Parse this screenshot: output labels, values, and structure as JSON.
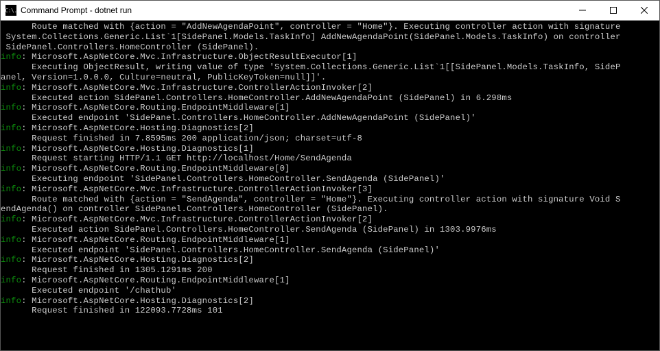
{
  "window": {
    "icon_text": "C:\\.",
    "title": "Command Prompt - dotnet  run"
  },
  "terminal": {
    "info_label": "info",
    "lines": [
      {
        "type": "indent6",
        "text": "Route matched with {action = \"AddNewAgendaPoint\", controller = \"Home\"}. Executing controller action with signature"
      },
      {
        "type": "plain",
        "text": " System.Collections.Generic.List`1[SidePanel.Models.TaskInfo] AddNewAgendaPoint(SidePanel.Models.TaskInfo) on controller"
      },
      {
        "type": "plain",
        "text": " SidePanel.Controllers.HomeController (SidePanel)."
      },
      {
        "type": "info",
        "text": "Microsoft.AspNetCore.Mvc.Infrastructure.ObjectResultExecutor[1]"
      },
      {
        "type": "indent6",
        "text": "Executing ObjectResult, writing value of type 'System.Collections.Generic.List`1[[SidePanel.Models.TaskInfo, SideP"
      },
      {
        "type": "plain",
        "text": "anel, Version=1.0.0.0, Culture=neutral, PublicKeyToken=null]]'."
      },
      {
        "type": "info",
        "text": "Microsoft.AspNetCore.Mvc.Infrastructure.ControllerActionInvoker[2]"
      },
      {
        "type": "indent6",
        "text": "Executed action SidePanel.Controllers.HomeController.AddNewAgendaPoint (SidePanel) in 6.298ms"
      },
      {
        "type": "info",
        "text": "Microsoft.AspNetCore.Routing.EndpointMiddleware[1]"
      },
      {
        "type": "indent6",
        "text": "Executed endpoint 'SidePanel.Controllers.HomeController.AddNewAgendaPoint (SidePanel)'"
      },
      {
        "type": "info",
        "text": "Microsoft.AspNetCore.Hosting.Diagnostics[2]"
      },
      {
        "type": "indent6",
        "text": "Request finished in 7.8595ms 200 application/json; charset=utf-8"
      },
      {
        "type": "info",
        "text": "Microsoft.AspNetCore.Hosting.Diagnostics[1]"
      },
      {
        "type": "indent6",
        "text": "Request starting HTTP/1.1 GET http://localhost/Home/SendAgenda"
      },
      {
        "type": "info",
        "text": "Microsoft.AspNetCore.Routing.EndpointMiddleware[0]"
      },
      {
        "type": "indent6",
        "text": "Executing endpoint 'SidePanel.Controllers.HomeController.SendAgenda (SidePanel)'"
      },
      {
        "type": "info",
        "text": "Microsoft.AspNetCore.Mvc.Infrastructure.ControllerActionInvoker[3]"
      },
      {
        "type": "indent6",
        "text": "Route matched with {action = \"SendAgenda\", controller = \"Home\"}. Executing controller action with signature Void S"
      },
      {
        "type": "plain",
        "text": "endAgenda() on controller SidePanel.Controllers.HomeController (SidePanel)."
      },
      {
        "type": "info",
        "text": "Microsoft.AspNetCore.Mvc.Infrastructure.ControllerActionInvoker[2]"
      },
      {
        "type": "indent6",
        "text": "Executed action SidePanel.Controllers.HomeController.SendAgenda (SidePanel) in 1303.9976ms"
      },
      {
        "type": "info",
        "text": "Microsoft.AspNetCore.Routing.EndpointMiddleware[1]"
      },
      {
        "type": "indent6",
        "text": "Executed endpoint 'SidePanel.Controllers.HomeController.SendAgenda (SidePanel)'"
      },
      {
        "type": "info",
        "text": "Microsoft.AspNetCore.Hosting.Diagnostics[2]"
      },
      {
        "type": "indent6",
        "text": "Request finished in 1305.1291ms 200"
      },
      {
        "type": "info",
        "text": "Microsoft.AspNetCore.Routing.EndpointMiddleware[1]"
      },
      {
        "type": "indent6",
        "text": "Executed endpoint '/chathub'"
      },
      {
        "type": "info",
        "text": "Microsoft.AspNetCore.Hosting.Diagnostics[2]"
      },
      {
        "type": "indent6",
        "text": "Request finished in 122093.7728ms 101"
      }
    ]
  }
}
